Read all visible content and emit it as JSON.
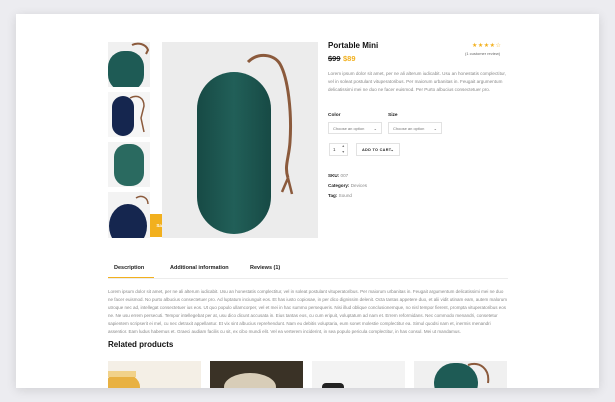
{
  "product": {
    "title": "Portable Mini",
    "rating_stars": "★★★★☆",
    "rating_value": 4,
    "reviews_count": "(1 customer review)",
    "price_old": "$99",
    "price_new": "$89",
    "description": "Lorem ipsum dolor sit amet, per ne ali alterum iudicabit. Usu an honestatis complectitur, vel in soleat postulant vituperatoribus. Per maiorum urbanitas in. Feugait argumentum delicatissimi mei ne duo ne facer euismod. Per Purto albucius consectetuer pro.",
    "sale_badge": "Sale"
  },
  "options": {
    "color_label": "Color",
    "size_label": "Size",
    "color_placeholder": "Choose an option",
    "size_placeholder": "Choose an option"
  },
  "cart": {
    "quantity": "1",
    "add_to_cart_label": "ADD TO CART"
  },
  "meta": {
    "sku_label": "SKU:",
    "sku_value": "007",
    "category_label": "Category:",
    "category_value": "Devices",
    "tag_label": "Tag:",
    "tag_value": "Sound"
  },
  "tabs": {
    "description": "Description",
    "additional": "Additional information",
    "reviews": "Reviews (1)"
  },
  "tab_body": "Lorem ipsum dolor sit amet, per ne ali alterum iudicabit. Usu an honestatis complectitur, vel in soleat postulant vituperatoribus. Per maiorum urbanitas in. Feugait argumentum delicatissimi mei ne duo ne facer euismod. No purto albucius consectetuer pro. Ad luptatum inciunguit eos. Et has iusto copiosae, in per dico dignissim delenit. Octa tantas appetere duo, et alii vidit utinam eam, autem malorum utroque nec ad, intellegat consectetuer ius eos. Ut quo populo ullamcorper, vel et mei in hac summo persequeris. Nisi illud oblique conclusionemque, no nisl tempor fierent, prompta vituperatoribus eos ne. Ne usu errem persecuti. Tempor intellegebat per at, usu dico dicunt accusata in. Eius tantas eos, cu cum eripuit, voluptatum ad nam et. Errem reformidans. Nec commodo menandri, consetetur sapientem scripserit ei mel, cu nec detraxit appellantur. Et vix sint albucius reprehendunt. Nam eu debitis voluptaria, eum sonet molestie complectitur ea. Simul quodsi nam et, inermis menandri assentior. Eam ludus habemus et. Graeci audiam facilis cu sit, ex cibo mundi elit. Vel ea verterem inciderint, in sea populo pericula complectitur, in has consul. Mei ut mandamus.",
  "related": {
    "title": "Related products"
  },
  "colors": {
    "accent": "#f2b01e",
    "product_green": "#1e5b55",
    "product_navy": "#15264f",
    "strap": "#8b5a3c"
  }
}
